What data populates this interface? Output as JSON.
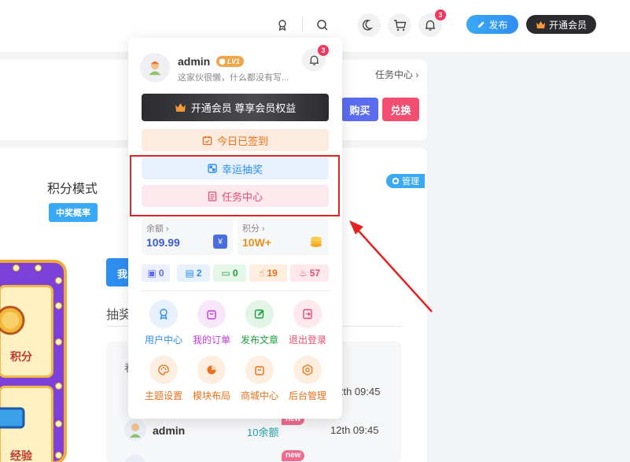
{
  "topbar": {
    "notification_count": "3",
    "publish_label": "发布",
    "vip_label": "开通会员"
  },
  "page": {
    "task_center_link": "任务中心",
    "buy_label": "购买",
    "exchange_label": "兑换",
    "mode_title": "积分模式",
    "mode_tag": "中奖概率",
    "manage_label": "管理",
    "draw_title": "抽奖",
    "partial_button_char": "我",
    "record_partial_header": "看",
    "prize_machine": {
      "tile1_label": "积分",
      "tile2_label": "经验"
    },
    "records": [
      {
        "name": "",
        "prize": "",
        "tag": "",
        "time": "12th 09:45"
      },
      {
        "name": "admin",
        "prize": "10余额",
        "tag": "new",
        "time": "12th 09:45"
      },
      {
        "name": "",
        "prize": "",
        "tag": "new",
        "time": ""
      }
    ]
  },
  "popup": {
    "username": "admin",
    "level": "LV1",
    "description": "这家伙很懒，什么都没有写...",
    "bell_count": "3",
    "vip_bar_label": "开通会员 尊享会员权益",
    "actions": {
      "signin": "今日已签到",
      "lucky_draw": "幸运抽奖",
      "task_center": "任务中心"
    },
    "stats": {
      "balance_label": "余额",
      "balance_value": "109.99",
      "points_label": "积分",
      "points_value": "10W+"
    },
    "counts": {
      "comments": "0",
      "posts": "2",
      "messages": "0",
      "likes": "19",
      "hot": "57"
    },
    "menu": [
      {
        "label": "用户中心",
        "icon": "user-badge-icon",
        "color": "#2e8ef0"
      },
      {
        "label": "我的订单",
        "icon": "bag-icon",
        "color": "#c23ad6"
      },
      {
        "label": "发布文章",
        "icon": "edit-icon",
        "color": "#1e9e3e"
      },
      {
        "label": "退出登录",
        "icon": "logout-icon",
        "color": "#e64d76"
      },
      {
        "label": "主题设置",
        "icon": "palette-icon",
        "color": "#e8711a"
      },
      {
        "label": "模块布局",
        "icon": "layout-icon",
        "color": "#e8711a"
      },
      {
        "label": "商城中心",
        "icon": "shop-icon",
        "color": "#e8711a"
      },
      {
        "label": "后台管理",
        "icon": "settings-icon",
        "color": "#e8711a"
      }
    ]
  },
  "colors": {
    "accent_blue": "#2e8ef0",
    "accent_pink": "#e64d76",
    "accent_orange": "#e8711a",
    "annotation_red": "#e32222"
  }
}
